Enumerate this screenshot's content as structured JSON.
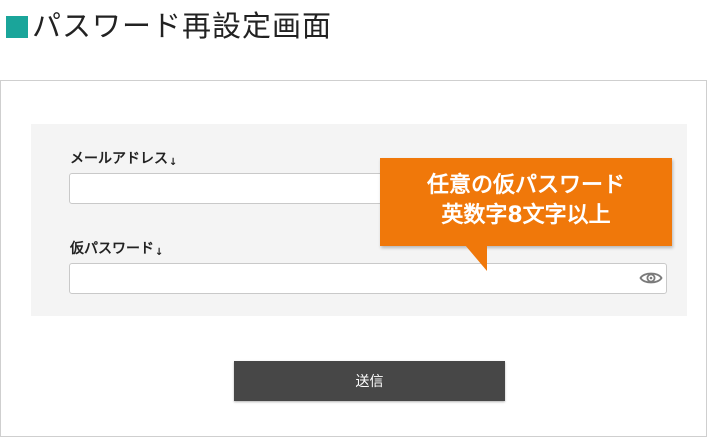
{
  "page": {
    "title": "パスワード再設定画面",
    "accent_color": "#1aa59a"
  },
  "form": {
    "email": {
      "label": "メールアドレス",
      "required_mark": "↓",
      "value": ""
    },
    "temp_password": {
      "label": "仮パスワード",
      "required_mark": "↓",
      "value": "",
      "toggle_icon": "eye-icon"
    },
    "submit_label": "送信"
  },
  "callout": {
    "line1": "任意の仮パスワード",
    "line2": "英数字8文字以上",
    "color": "#f0780a"
  }
}
